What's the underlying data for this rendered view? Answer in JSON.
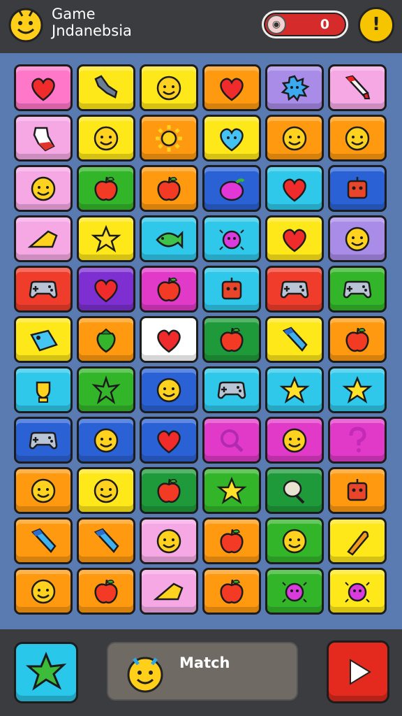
{
  "header": {
    "title_line1": "Game",
    "title_line2": "Jndanebsia",
    "score_value": "0",
    "hint_symbol": "!"
  },
  "colors": {
    "pink": "#ff77c8",
    "yellow": "#ffe81a",
    "orange": "#ff9a10",
    "purple": "#a98be8",
    "lightpink": "#f6a8e4",
    "green": "#33b52a",
    "blue": "#2a62d6",
    "cyan": "#2fc7ea",
    "red": "#f03d2b",
    "magenta": "#e13ac8",
    "violet": "#7d2fd1",
    "white": "#ffffff",
    "dkgreen": "#1e9a3a"
  },
  "board": {
    "rows": [
      [
        {
          "bg": "pink",
          "icon": "heart-icon"
        },
        {
          "bg": "yellow",
          "icon": "wrench-icon"
        },
        {
          "bg": "yellow",
          "icon": "smiley-icon"
        },
        {
          "bg": "orange",
          "icon": "heart-icon"
        },
        {
          "bg": "purple",
          "icon": "splat-icon"
        },
        {
          "bg": "lightpink",
          "icon": "paintbrush-icon"
        }
      ],
      [
        {
          "bg": "lightpink",
          "icon": "glass-icon"
        },
        {
          "bg": "yellow",
          "icon": "smiley-icon"
        },
        {
          "bg": "orange",
          "icon": "sun-icon"
        },
        {
          "bg": "yellow",
          "icon": "heart-face-icon"
        },
        {
          "bg": "orange",
          "icon": "smiley-icon"
        },
        {
          "bg": "orange",
          "icon": "smiley-icon"
        }
      ],
      [
        {
          "bg": "lightpink",
          "icon": "smiley-icon"
        },
        {
          "bg": "green",
          "icon": "apple-icon"
        },
        {
          "bg": "orange",
          "icon": "apple-icon"
        },
        {
          "bg": "blue",
          "icon": "berry-icon"
        },
        {
          "bg": "cyan",
          "icon": "heart-icon"
        },
        {
          "bg": "blue",
          "icon": "robot-icon"
        }
      ],
      [
        {
          "bg": "lightpink",
          "icon": "cheese-icon"
        },
        {
          "bg": "yellow",
          "icon": "star-icon"
        },
        {
          "bg": "cyan",
          "icon": "fish-icon"
        },
        {
          "bg": "cyan",
          "icon": "bug-icon"
        },
        {
          "bg": "yellow",
          "icon": "heart-icon"
        },
        {
          "bg": "purple",
          "icon": "smiley-icon"
        }
      ],
      [
        {
          "bg": "red",
          "icon": "gamepad-icon"
        },
        {
          "bg": "violet",
          "icon": "heart-icon"
        },
        {
          "bg": "magenta",
          "icon": "apple-icon"
        },
        {
          "bg": "cyan",
          "icon": "robot-icon"
        },
        {
          "bg": "red",
          "icon": "gamepad-icon"
        },
        {
          "bg": "green",
          "icon": "gamepad-icon"
        }
      ],
      [
        {
          "bg": "yellow",
          "icon": "tag-icon"
        },
        {
          "bg": "orange",
          "icon": "strawberry-icon"
        },
        {
          "bg": "white",
          "icon": "heart-icon"
        },
        {
          "bg": "dkgreen",
          "icon": "apple-icon"
        },
        {
          "bg": "yellow",
          "icon": "bottle-icon"
        },
        {
          "bg": "orange",
          "icon": "apple-icon"
        }
      ],
      [
        {
          "bg": "cyan",
          "icon": "trophy-icon"
        },
        {
          "bg": "green",
          "icon": "leaf-icon"
        },
        {
          "bg": "blue",
          "icon": "smiley-icon"
        },
        {
          "bg": "cyan",
          "icon": "gamepad-icon"
        },
        {
          "bg": "cyan",
          "icon": "star-icon"
        },
        {
          "bg": "cyan",
          "icon": "star-icon"
        }
      ],
      [
        {
          "bg": "blue",
          "icon": "gamepad-icon"
        },
        {
          "bg": "blue",
          "icon": "smiley-icon"
        },
        {
          "bg": "blue",
          "icon": "heart-icon"
        },
        {
          "bg": "magenta",
          "icon": "magnifier-icon"
        },
        {
          "bg": "magenta",
          "icon": "smiley-icon"
        },
        {
          "bg": "magenta",
          "icon": "question-icon"
        }
      ],
      [
        {
          "bg": "orange",
          "icon": "smiley-icon"
        },
        {
          "bg": "yellow",
          "icon": "smiley-icon"
        },
        {
          "bg": "dkgreen",
          "icon": "apple-icon"
        },
        {
          "bg": "green",
          "icon": "star-icon"
        },
        {
          "bg": "dkgreen",
          "icon": "spoon-icon"
        },
        {
          "bg": "orange",
          "icon": "robot-icon"
        }
      ],
      [
        {
          "bg": "orange",
          "icon": "bottle-icon"
        },
        {
          "bg": "orange",
          "icon": "bottle-icon"
        },
        {
          "bg": "lightpink",
          "icon": "smiley-icon"
        },
        {
          "bg": "orange",
          "icon": "apple-icon"
        },
        {
          "bg": "green",
          "icon": "smiley-icon"
        },
        {
          "bg": "yellow",
          "icon": "carrot-icon"
        }
      ],
      [
        {
          "bg": "orange",
          "icon": "smiley-icon"
        },
        {
          "bg": "orange",
          "icon": "apple-icon"
        },
        {
          "bg": "lightpink",
          "icon": "cheese-icon"
        },
        {
          "bg": "orange",
          "icon": "apple-icon"
        },
        {
          "bg": "green",
          "icon": "bug-icon"
        },
        {
          "bg": "yellow",
          "icon": "bug-icon"
        }
      ]
    ]
  },
  "bottom": {
    "match_label": "Match"
  }
}
